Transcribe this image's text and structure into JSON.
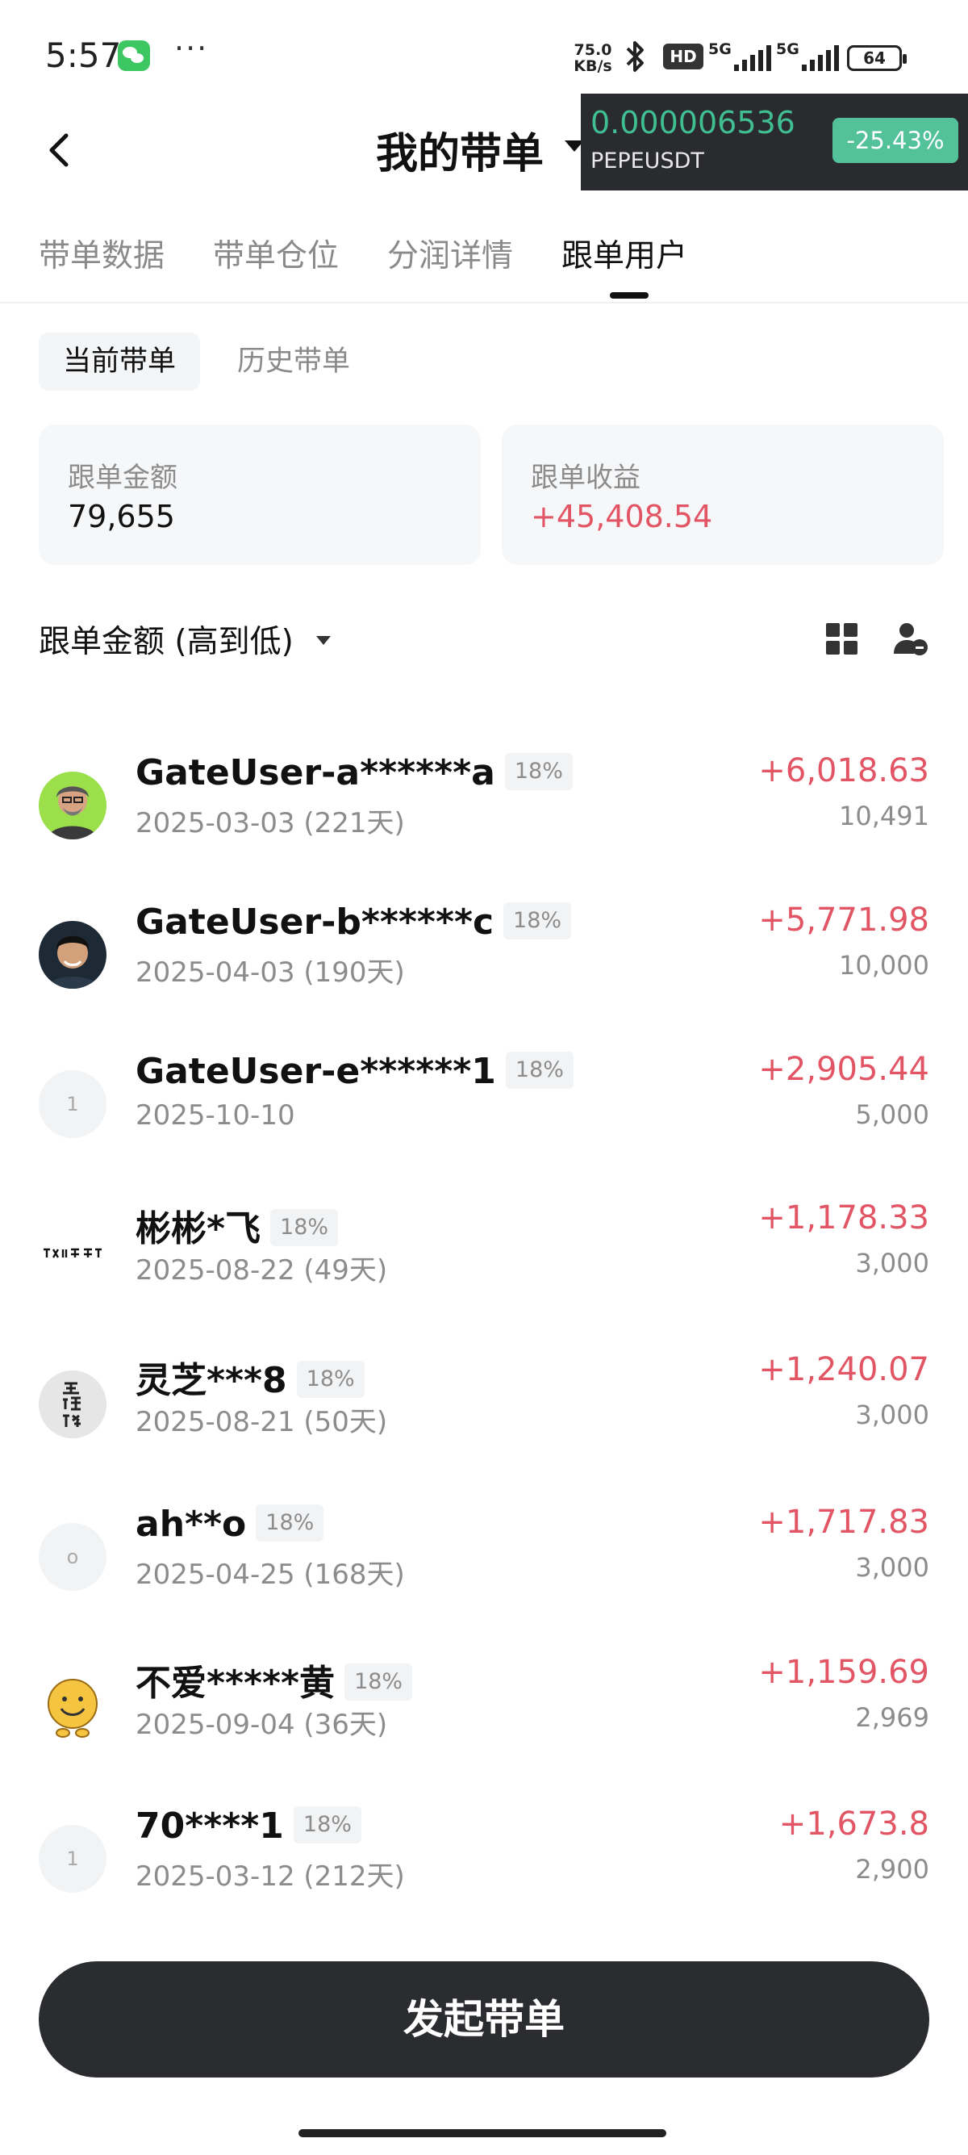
{
  "status_bar": {
    "time": "5:57",
    "dots": "···",
    "speed_value": "75.0",
    "speed_unit": "KB/s",
    "hd": "HD",
    "net_1": "5G",
    "net_2": "5G",
    "battery": "64"
  },
  "header": {
    "title": "我的带单"
  },
  "ticker": {
    "price": "0.000006536",
    "pair": "PEPEUSDT",
    "change": "-25.43%",
    "color": "#53c19a"
  },
  "tabs": [
    {
      "label": "带单数据",
      "active": false
    },
    {
      "label": "带单仓位",
      "active": false
    },
    {
      "label": "分润详情",
      "active": false
    },
    {
      "label": "跟单用户",
      "active": true
    }
  ],
  "sub_tabs": [
    {
      "label": "当前带单",
      "active": true
    },
    {
      "label": "历史带单",
      "active": false
    }
  ],
  "summary": {
    "amount_label": "跟单金额",
    "amount_value": "79,655",
    "profit_label": "跟单收益",
    "profit_value": "+45,408.54",
    "profit_color": "#e25564"
  },
  "sort": {
    "label": "跟单金额 (高到低)"
  },
  "followers": [
    {
      "name": "GateUser-a******a",
      "badge": "18%",
      "date": "2025-03-03 (221天)",
      "profit": "+6,018.63",
      "amount": "10,491",
      "avatar": "photo-man-glasses"
    },
    {
      "name": "GateUser-b******c",
      "badge": "18%",
      "date": "2025-04-03 (190天)",
      "profit": "+5,771.98",
      "amount": "10,000",
      "avatar": "photo-man"
    },
    {
      "name": "GateUser-e******1",
      "badge": "18%",
      "date": "2025-10-10",
      "profit": "+2,905.44",
      "amount": "5,000",
      "avatar": "1"
    },
    {
      "name": "彬彬*飞",
      "badge": "18%",
      "date": "2025-08-22 (49天)",
      "profit": "+1,178.33",
      "amount": "3,000",
      "avatar": "text-logo"
    },
    {
      "name": "灵芝***8",
      "badge": "18%",
      "date": "2025-08-21 (50天)",
      "profit": "+1,240.07",
      "amount": "3,000",
      "avatar": "seal"
    },
    {
      "name": "ah**o",
      "badge": "18%",
      "date": "2025-04-25 (168天)",
      "profit": "+1,717.83",
      "amount": "3,000",
      "avatar": "o"
    },
    {
      "name": "不爱*****黄",
      "badge": "18%",
      "date": "2025-09-04 (36天)",
      "profit": "+1,159.69",
      "amount": "2,969",
      "avatar": "smiley"
    },
    {
      "name": "70****1",
      "badge": "18%",
      "date": "2025-03-12 (212天)",
      "profit": "+1,673.8",
      "amount": "2,900",
      "avatar": "1"
    }
  ],
  "cta": {
    "label": "发起带单"
  }
}
